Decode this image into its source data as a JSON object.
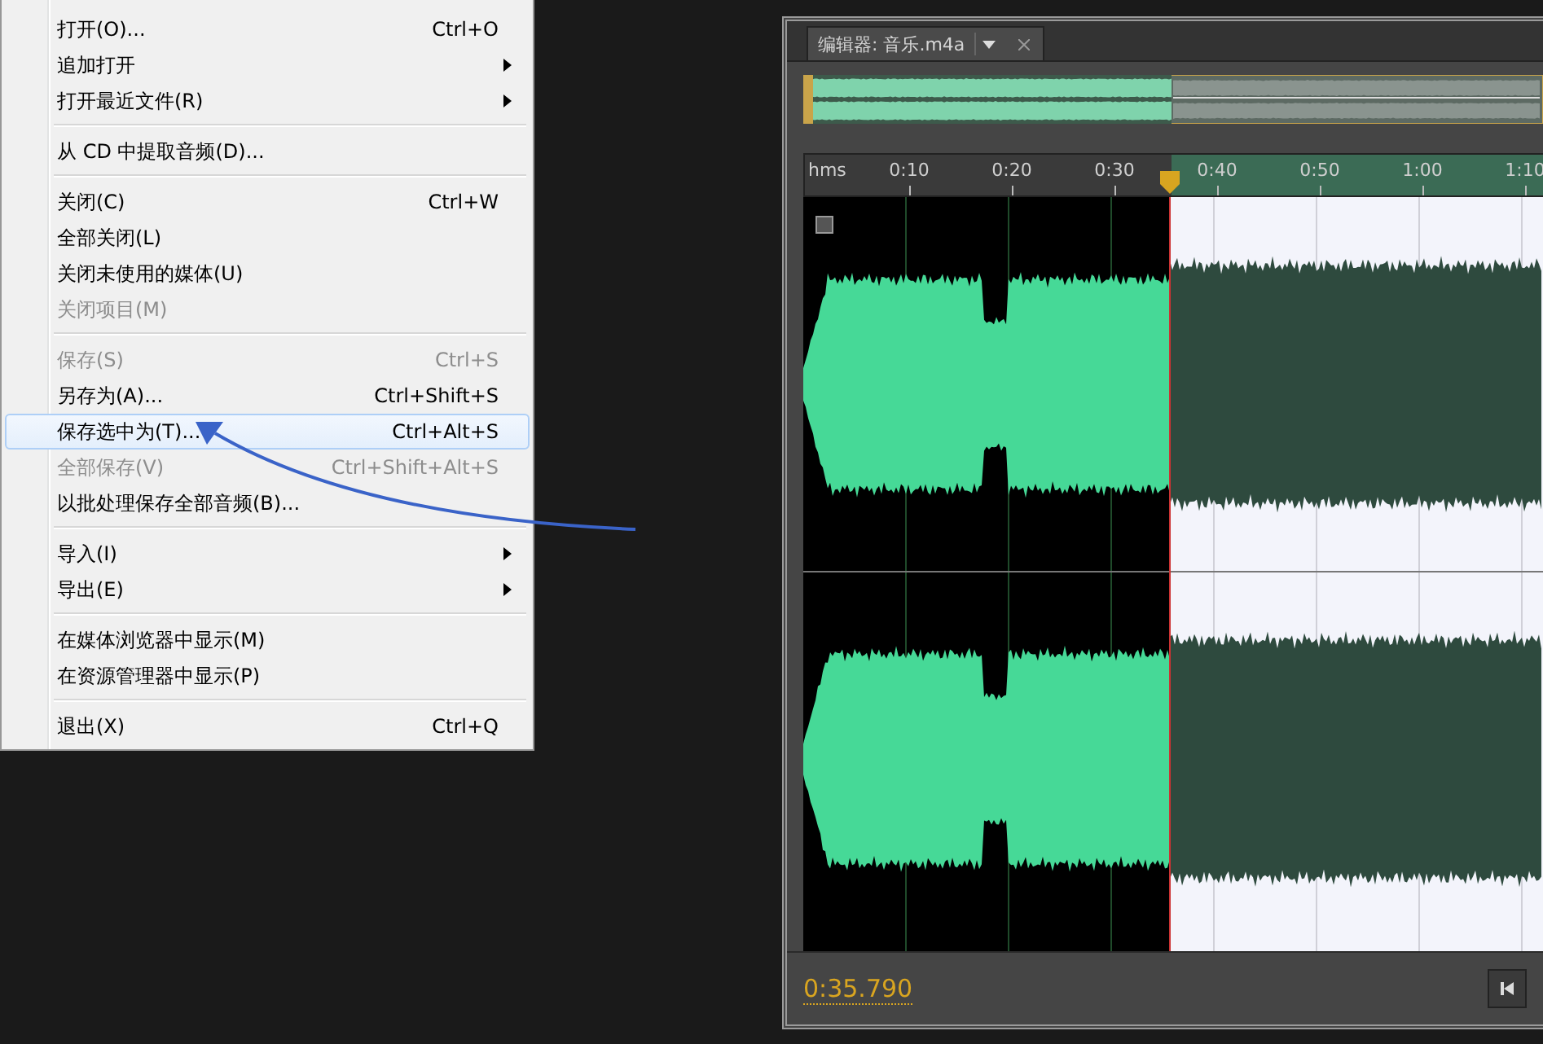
{
  "file_menu": {
    "items": [
      {
        "kind": "item",
        "label": "打开(O)...",
        "shortcut": "Ctrl+O",
        "submenu": false,
        "disabled": false,
        "selected": false
      },
      {
        "kind": "item",
        "label": "追加打开",
        "submenu": true,
        "disabled": false,
        "selected": false
      },
      {
        "kind": "item",
        "label": "打开最近文件(R)",
        "submenu": true,
        "disabled": false,
        "selected": false
      },
      {
        "kind": "separator"
      },
      {
        "kind": "item",
        "label": "从 CD 中提取音频(D)...",
        "submenu": false,
        "disabled": false,
        "selected": false
      },
      {
        "kind": "separator"
      },
      {
        "kind": "item",
        "label": "关闭(C)",
        "shortcut": "Ctrl+W",
        "submenu": false,
        "disabled": false,
        "selected": false
      },
      {
        "kind": "item",
        "label": "全部关闭(L)",
        "submenu": false,
        "disabled": false,
        "selected": false
      },
      {
        "kind": "item",
        "label": "关闭未使用的媒体(U)",
        "submenu": false,
        "disabled": false,
        "selected": false
      },
      {
        "kind": "item",
        "label": "关闭项目(M)",
        "submenu": false,
        "disabled": true,
        "selected": false
      },
      {
        "kind": "separator"
      },
      {
        "kind": "item",
        "label": "保存(S)",
        "shortcut": "Ctrl+S",
        "submenu": false,
        "disabled": true,
        "selected": false
      },
      {
        "kind": "item",
        "label": "另存为(A)...",
        "shortcut": "Ctrl+Shift+S",
        "submenu": false,
        "disabled": false,
        "selected": false
      },
      {
        "kind": "item",
        "label": "保存选中为(T)...",
        "shortcut": "Ctrl+Alt+S",
        "submenu": false,
        "disabled": false,
        "selected": true
      },
      {
        "kind": "item",
        "label": "全部保存(V)",
        "shortcut": "Ctrl+Shift+Alt+S",
        "submenu": false,
        "disabled": true,
        "selected": false
      },
      {
        "kind": "item",
        "label": "以批处理保存全部音频(B)...",
        "submenu": false,
        "disabled": false,
        "selected": false
      },
      {
        "kind": "separator"
      },
      {
        "kind": "item",
        "label": "导入(I)",
        "submenu": true,
        "disabled": false,
        "selected": false
      },
      {
        "kind": "item",
        "label": "导出(E)",
        "submenu": true,
        "disabled": false,
        "selected": false
      },
      {
        "kind": "separator"
      },
      {
        "kind": "item",
        "label": "在媒体浏览器中显示(M)",
        "submenu": false,
        "disabled": false,
        "selected": false
      },
      {
        "kind": "item",
        "label": "在资源管理器中显示(P)",
        "submenu": false,
        "disabled": false,
        "selected": false
      },
      {
        "kind": "separator"
      },
      {
        "kind": "item",
        "label": "退出(X)",
        "shortcut": "Ctrl+Q",
        "submenu": false,
        "disabled": false,
        "selected": false
      }
    ]
  },
  "editor": {
    "tab": {
      "label": "编辑器: 音乐.m4a",
      "selected": true
    },
    "ruler": {
      "unit": "hms",
      "ticks": [
        "0:10",
        "0:20",
        "0:30",
        "0:40",
        "0:50",
        "1:00",
        "1:10"
      ]
    },
    "time_display": "0:35.790"
  }
}
